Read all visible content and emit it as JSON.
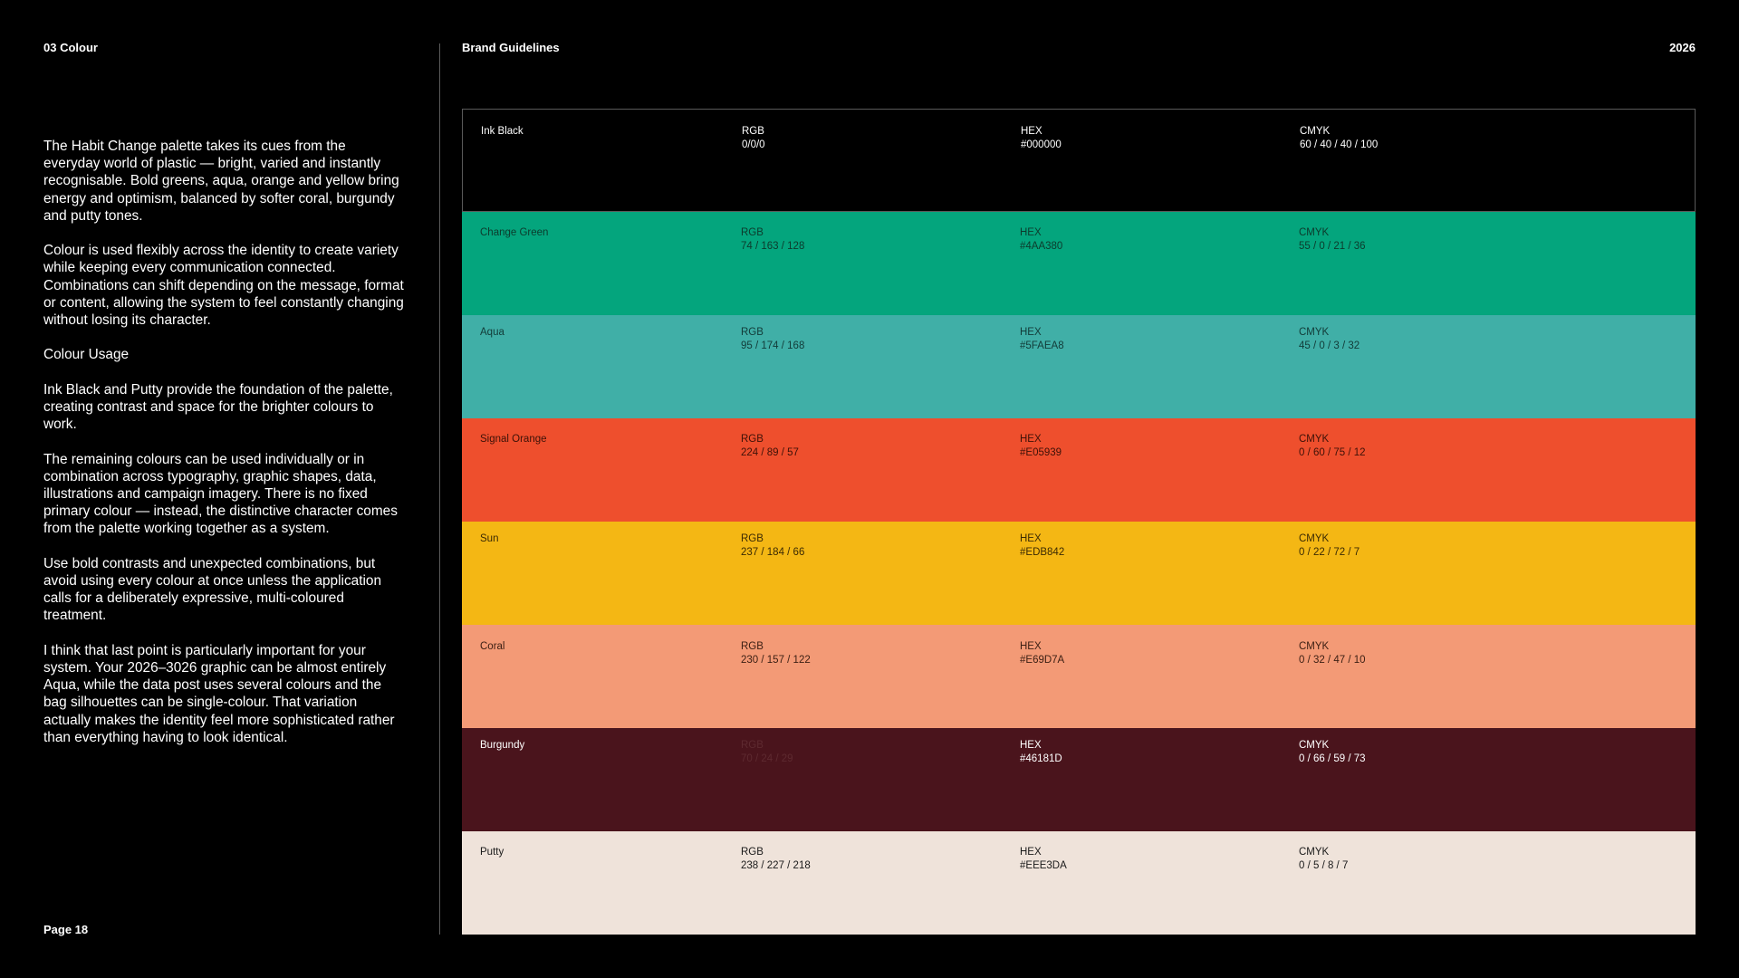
{
  "header": {
    "section": "03  Colour",
    "title": "Brand Guidelines",
    "year": "2026"
  },
  "intro": {
    "p1": "The Habit Change palette takes its cues from the everyday world of plastic — bright, varied and instantly recognisable. Bold greens, aqua, orange and yellow bring energy and optimism, balanced by softer coral, burgundy and putty tones.",
    "p2": "Colour is used flexibly across the identity to create variety while keeping every communication connected. Combinations can shift depending on the message, format or content, allowing the system to feel constantly changing without losing its character.",
    "p3": "Colour Usage",
    "p4": "Ink Black and Putty provide the foundation of the palette, creating contrast and space for the brighter colours to work.",
    "p5": "The remaining colours can be used individually or in combination across typography, graphic shapes, data, illustrations and campaign imagery. There is no fixed primary colour — instead, the distinctive character comes from the palette working together as a system.",
    "p6": "Use bold contrasts and unexpected combinations, but avoid using every colour at once unless the application calls for a deliberately expressive, multi-coloured treatment.",
    "p7": "I think that last point is particularly important for your system. Your 2026–3026 graphic can be almost entirely Aqua, while the data post uses several colours and the bag silhouettes can be single-colour. That variation actually makes the identity feel more sophisticated rather than everything having to look identical."
  },
  "footer": {
    "page": "Page 18"
  },
  "labels": {
    "rgb": "RGB",
    "hex": "HEX",
    "cmyk": "CMYK"
  },
  "swatches": [
    {
      "name": "Ink Black",
      "rgb": "0/0/0",
      "hex": "#000000",
      "cmyk": "60 / 40 / 40 / 100",
      "bg": "#000000",
      "text": "#ffffff"
    },
    {
      "name": "Change Green",
      "rgb": "74 / 163 / 128",
      "hex": "#4AA380",
      "cmyk": "55 / 0 / 21 / 36",
      "bg": "#04A57D",
      "text": "#0d3a2c"
    },
    {
      "name": "Aqua",
      "rgb": "95 / 174 / 168",
      "hex": "#5FAEA8",
      "cmyk": "45 / 0 / 3 / 32",
      "bg": "#40AFA7",
      "text": "#123b38"
    },
    {
      "name": "Signal Orange",
      "rgb": "224 / 89 / 57",
      "hex": "#E05939",
      "cmyk": "0 / 60 / 75 / 12",
      "bg": "#EE4F2D",
      "text": "#3d1208"
    },
    {
      "name": "Sun",
      "rgb": "237 / 184 / 66",
      "hex": "#EDB842",
      "cmyk": "0 / 22 / 72 / 7",
      "bg": "#F4B714",
      "text": "#3b2a04"
    },
    {
      "name": "Coral",
      "rgb": "230 / 157 / 122",
      "hex": "#E69D7A",
      "cmyk": "0 / 32 / 47 / 10",
      "bg": "#F39A76",
      "text": "#3d2014"
    },
    {
      "name": "Burgundy",
      "rgb": "70 / 24 / 29",
      "hex": "#46181D",
      "cmyk": "0 / 66 / 59 / 73",
      "bg": "#4A141C",
      "text": "#ffffff",
      "rgb_text": "#5e2a30"
    },
    {
      "name": "Putty",
      "rgb": "238 / 227 / 218",
      "hex": "#EEE3DA",
      "cmyk": "0 / 5 / 8 / 7",
      "bg": "#EFE3DA",
      "text": "#1a1a1a"
    }
  ]
}
